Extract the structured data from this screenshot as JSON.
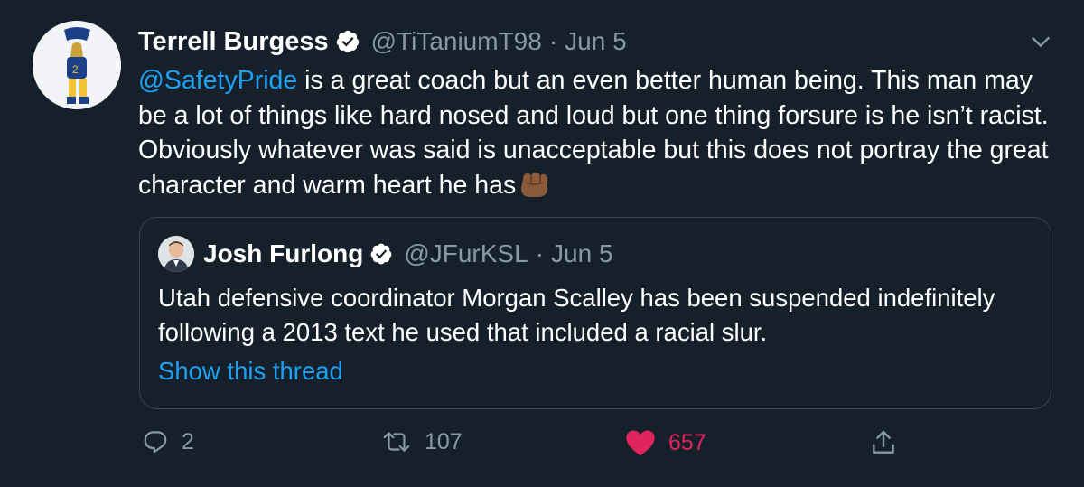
{
  "tweet": {
    "author_name": "Terrell Burgess",
    "author_handle": "@TiTaniumT98",
    "separator": "·",
    "date": "Jun 5",
    "mention": "@SafetyPride",
    "text": " is a great coach but an even better human being. This man may be a lot of things like hard nosed and loud but one thing forsure is he isn’t racist. Obviously whatever was said is unacceptable but this does not portray the great character and warm heart he has",
    "emoji": "raised-fist-medium-dark-skin-tone"
  },
  "quoted_tweet": {
    "author_name": "Josh Furlong",
    "author_handle": "@JFurKSL",
    "separator": "·",
    "date": "Jun 5",
    "text": "Utah defensive coordinator Morgan Scalley has been suspended indefinitely following a  2013 text he used that included a racial slur.",
    "show_thread": "Show this thread"
  },
  "actions": {
    "replies": "2",
    "retweets": "107",
    "likes": "657"
  },
  "icons": {
    "verified": "verified-badge-icon",
    "more": "chevron-down-icon",
    "reply": "reply-icon",
    "retweet": "retweet-icon",
    "like": "heart-icon",
    "share": "share-icon"
  },
  "colors": {
    "background": "#15202b",
    "text": "#ffffff",
    "secondary": "#8899a6",
    "link": "#1da1f2",
    "like": "#e0245e",
    "border": "#38444d"
  }
}
